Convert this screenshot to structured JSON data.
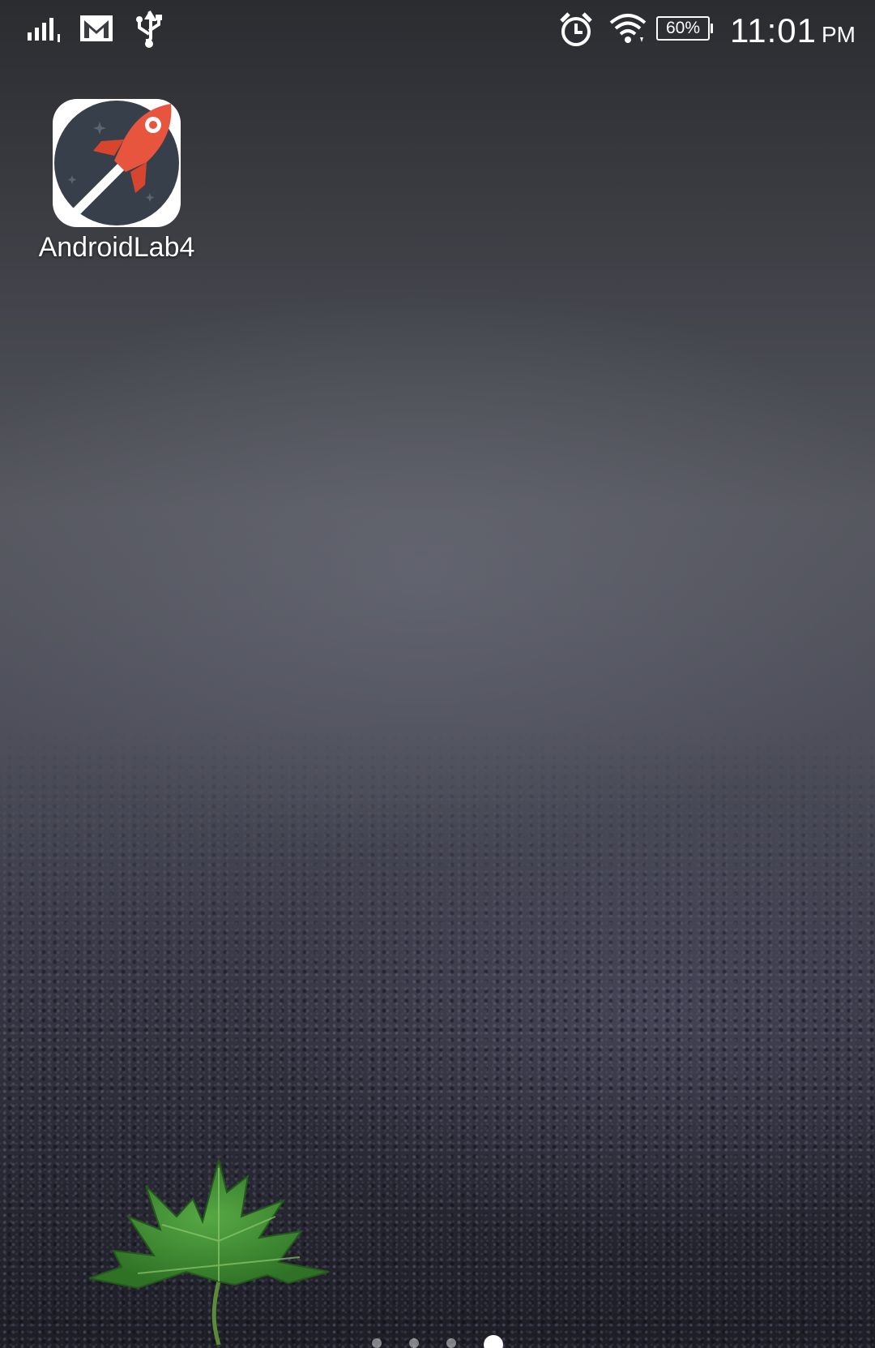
{
  "status_bar": {
    "icons": [
      "signal-icon",
      "gmail-icon",
      "usb-icon",
      "alarm-icon",
      "wifi-icon",
      "battery-icon"
    ],
    "battery_label": "60%",
    "battery_level": 0.6,
    "time": "11:01",
    "ampm": "PM"
  },
  "home": {
    "app": {
      "label": "AndroidLab4",
      "icon": "rocket-icon"
    },
    "wallpaper": "wet-asphalt-green-maple-leaf",
    "page_indicator": {
      "count": 4,
      "active": 4
    }
  },
  "colors": {
    "rocket_red": "#e8553f",
    "app_icon_bg": "#37404a",
    "leaf_green": "#3f8d33",
    "status_text": "#ffffff"
  }
}
